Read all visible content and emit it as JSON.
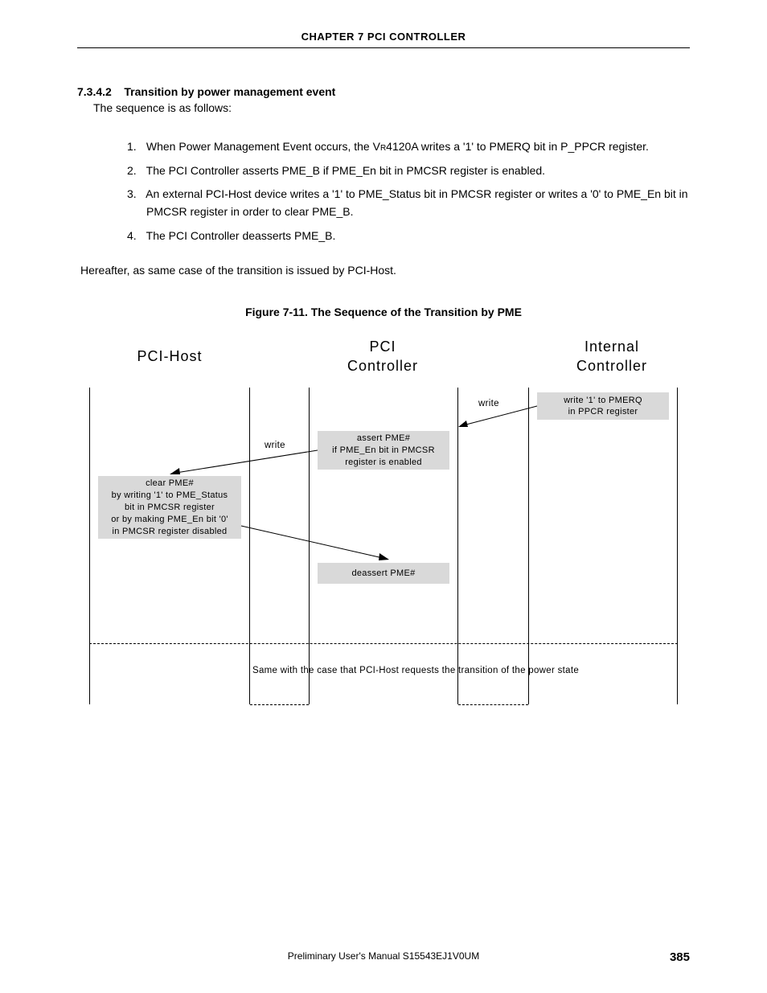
{
  "header": {
    "chapter": "CHAPTER  7   PCI CONTROLLER"
  },
  "section": {
    "number": "7.3.4.2",
    "title": "Transition by power management event",
    "intro": "The sequence is as follows:"
  },
  "steps": [
    {
      "n": "1.",
      "pre": "When Power Management Event occurs, the V",
      "sub": "R",
      "post": "4120A writes a '1' to PMERQ bit in P_PPCR register."
    },
    {
      "n": "2.",
      "pre": "The PCI Controller asserts PME_B if PME_En bit in PMCSR register is enabled.",
      "sub": "",
      "post": ""
    },
    {
      "n": "3.",
      "pre": "An external PCI-Host device writes a '1' to PME_Status bit in PMCSR register or writes a '0' to PME_En bit in PMCSR register in order to clear PME_B.",
      "sub": "",
      "post": ""
    },
    {
      "n": "4.",
      "pre": "The PCI Controller deasserts PME_B.",
      "sub": "",
      "post": ""
    }
  ],
  "hereafter": "Hereafter, as same case of the transition is issued by PCI-Host.",
  "figure": {
    "caption": "Figure 7-11.  The Sequence of the Transition by PME"
  },
  "diagram": {
    "col1": "PCI-Host",
    "col2a": "PCI",
    "col2b": "Controller",
    "col3a": "Internal",
    "col3b": "Controller",
    "box_internal_l1": "write '1' to PMERQ",
    "box_internal_l2": "in PPCR register",
    "label_write1": "write",
    "box_assert_l1": "assert PME#",
    "box_assert_l2": "if PME_En bit in PMCSR",
    "box_assert_l3": "register is enabled",
    "label_write2": "write",
    "box_clear_l1": "clear PME#",
    "box_clear_l2": "by writing '1' to PME_Status",
    "box_clear_l3": "bit in PMCSR register",
    "box_clear_l4": "or by making PME_En bit '0'",
    "box_clear_l5": "in PMCSR register disabled",
    "box_deassert": "deassert PME#",
    "footnote": "Same with the case that PCI-Host requests the transition of the power state"
  },
  "footer": {
    "center": "Preliminary User's Manual  S15543EJ1V0UM",
    "page": "385"
  }
}
